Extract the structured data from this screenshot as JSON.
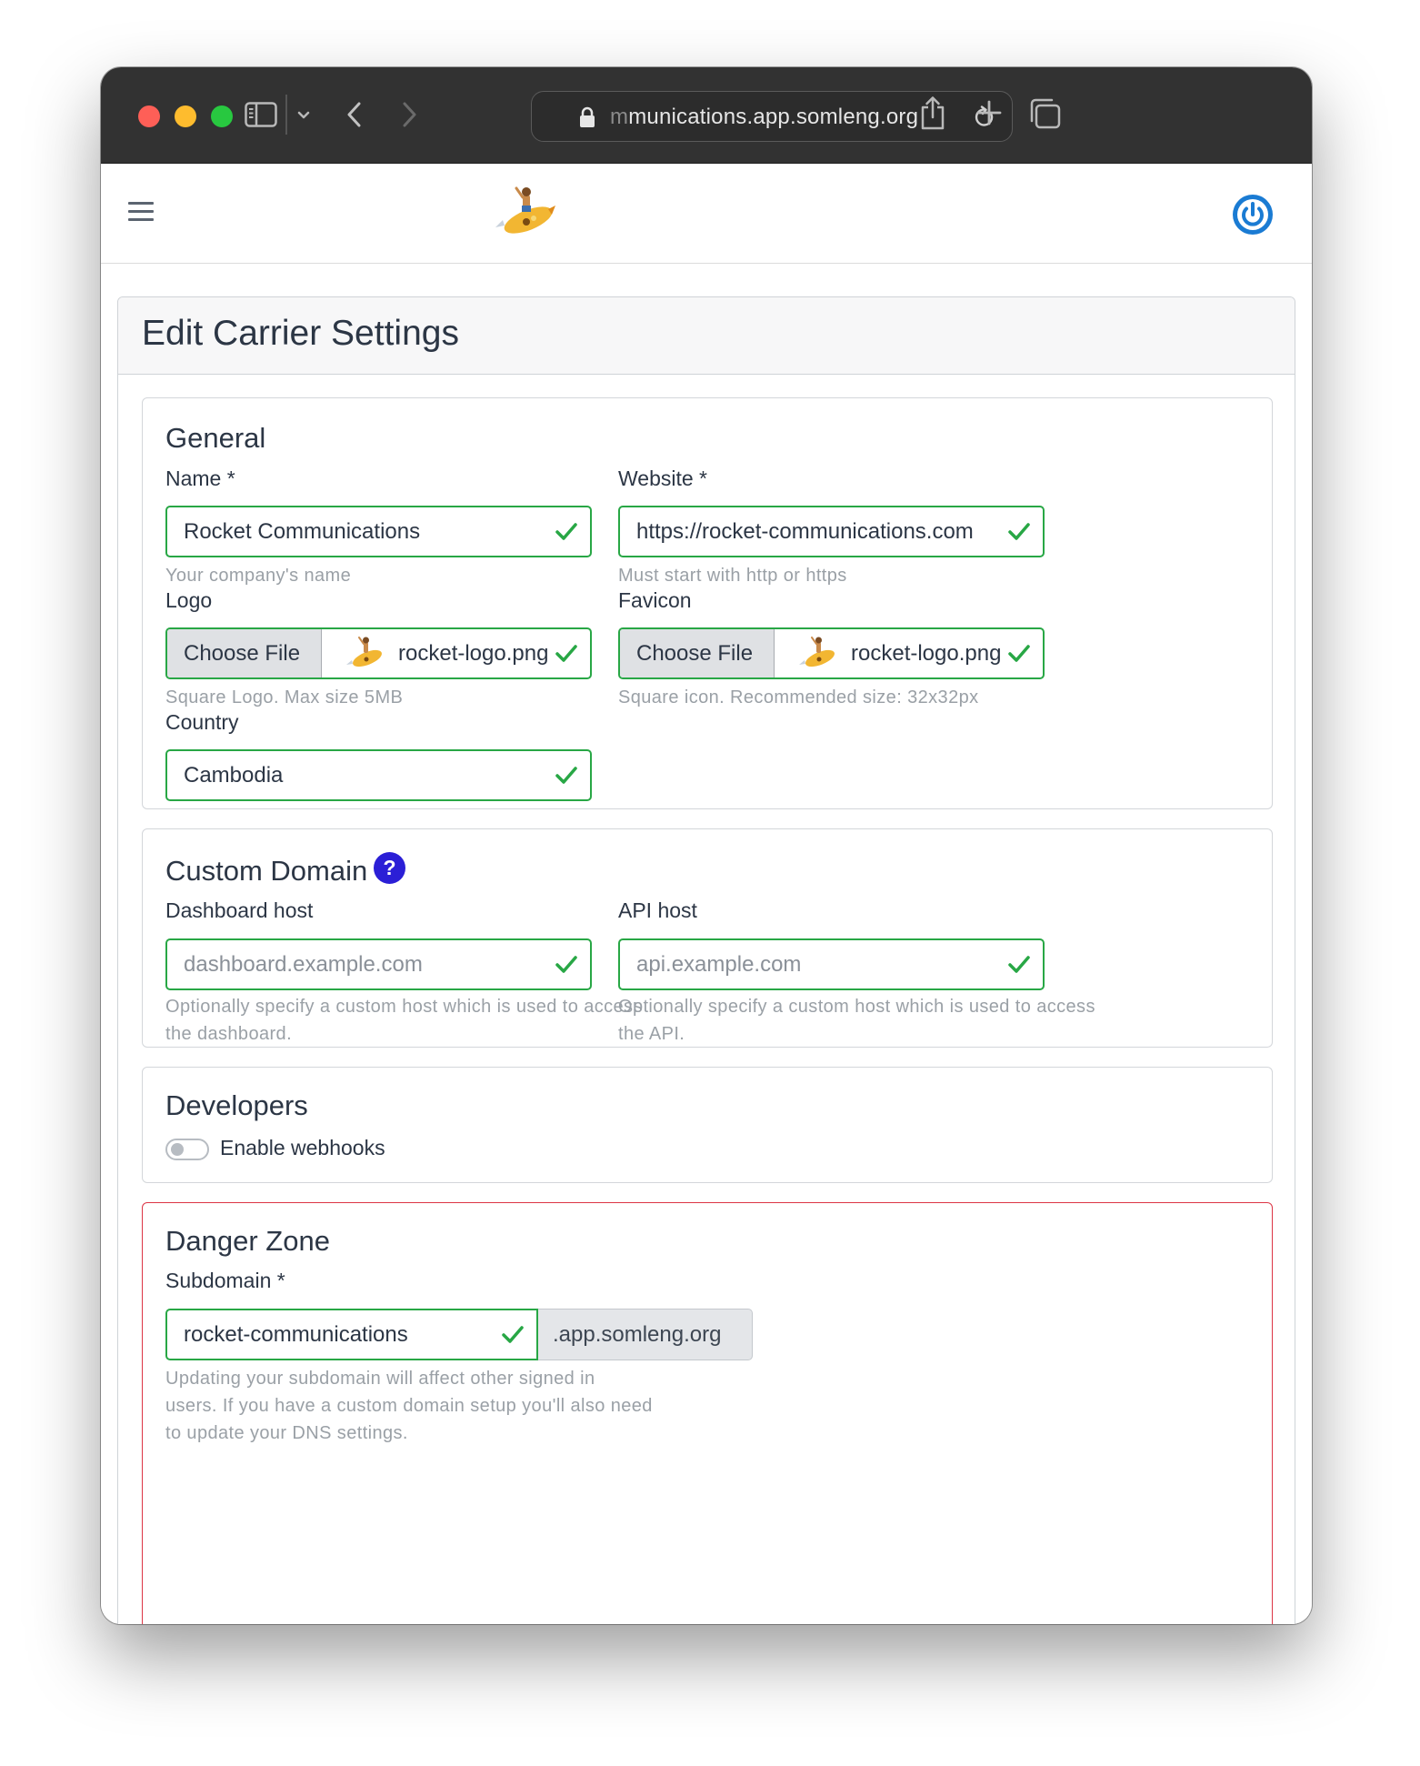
{
  "browser": {
    "url_faded": "m",
    "url_main": "munications.app.somleng.org"
  },
  "page": {
    "title": "Edit Carrier Settings"
  },
  "general": {
    "title": "General",
    "name_label": "Name *",
    "name_value": "Rocket Communications",
    "name_help": "Your company's name",
    "website_label": "Website *",
    "website_value": "https://rocket-communications.com",
    "website_help": "Must start with http or https",
    "logo_label": "Logo",
    "logo_button": "Choose File",
    "logo_file": "rocket-logo.png",
    "logo_help": "Square Logo. Max size 5MB",
    "favicon_label": "Favicon",
    "favicon_button": "Choose File",
    "favicon_file": "rocket-logo.png",
    "favicon_help": "Square icon. Recommended size: 32x32px",
    "country_label": "Country",
    "country_value": "Cambodia"
  },
  "custom_domain": {
    "title": "Custom Domain",
    "help_icon": "?",
    "dashboard_label": "Dashboard host",
    "dashboard_placeholder": "dashboard.example.com",
    "dashboard_help_1": "Optionally specify a custom host which is used to access",
    "dashboard_help_2": "the dashboard.",
    "api_label": "API host",
    "api_placeholder": "api.example.com",
    "api_help_1": "Optionally specify a custom host which is used to access",
    "api_help_2": "the API."
  },
  "developers": {
    "title": "Developers",
    "webhooks_label": "Enable webhooks",
    "webhooks_enabled": false
  },
  "danger_zone": {
    "title": "Danger Zone",
    "subdomain_label": "Subdomain *",
    "subdomain_value": "rocket-communications",
    "subdomain_suffix": ".app.somleng.org",
    "help_1": "Updating your subdomain will affect other signed in",
    "help_2": "users. If you have a custom domain setup you'll also need",
    "help_3": "to update your DNS settings."
  },
  "colors": {
    "valid": "#28a745",
    "danger": "#dc3545",
    "accent": "#2b1fd6",
    "power": "#1a7bd3"
  },
  "icons": [
    "sidebar-icon",
    "chevron-down-icon",
    "back-icon",
    "forward-icon",
    "lock-icon",
    "reload-icon",
    "share-icon",
    "new-tab-icon",
    "tabs-overview-icon",
    "hamburger-icon",
    "rocket-logo-icon",
    "power-icon",
    "check-icon",
    "help-icon"
  ]
}
